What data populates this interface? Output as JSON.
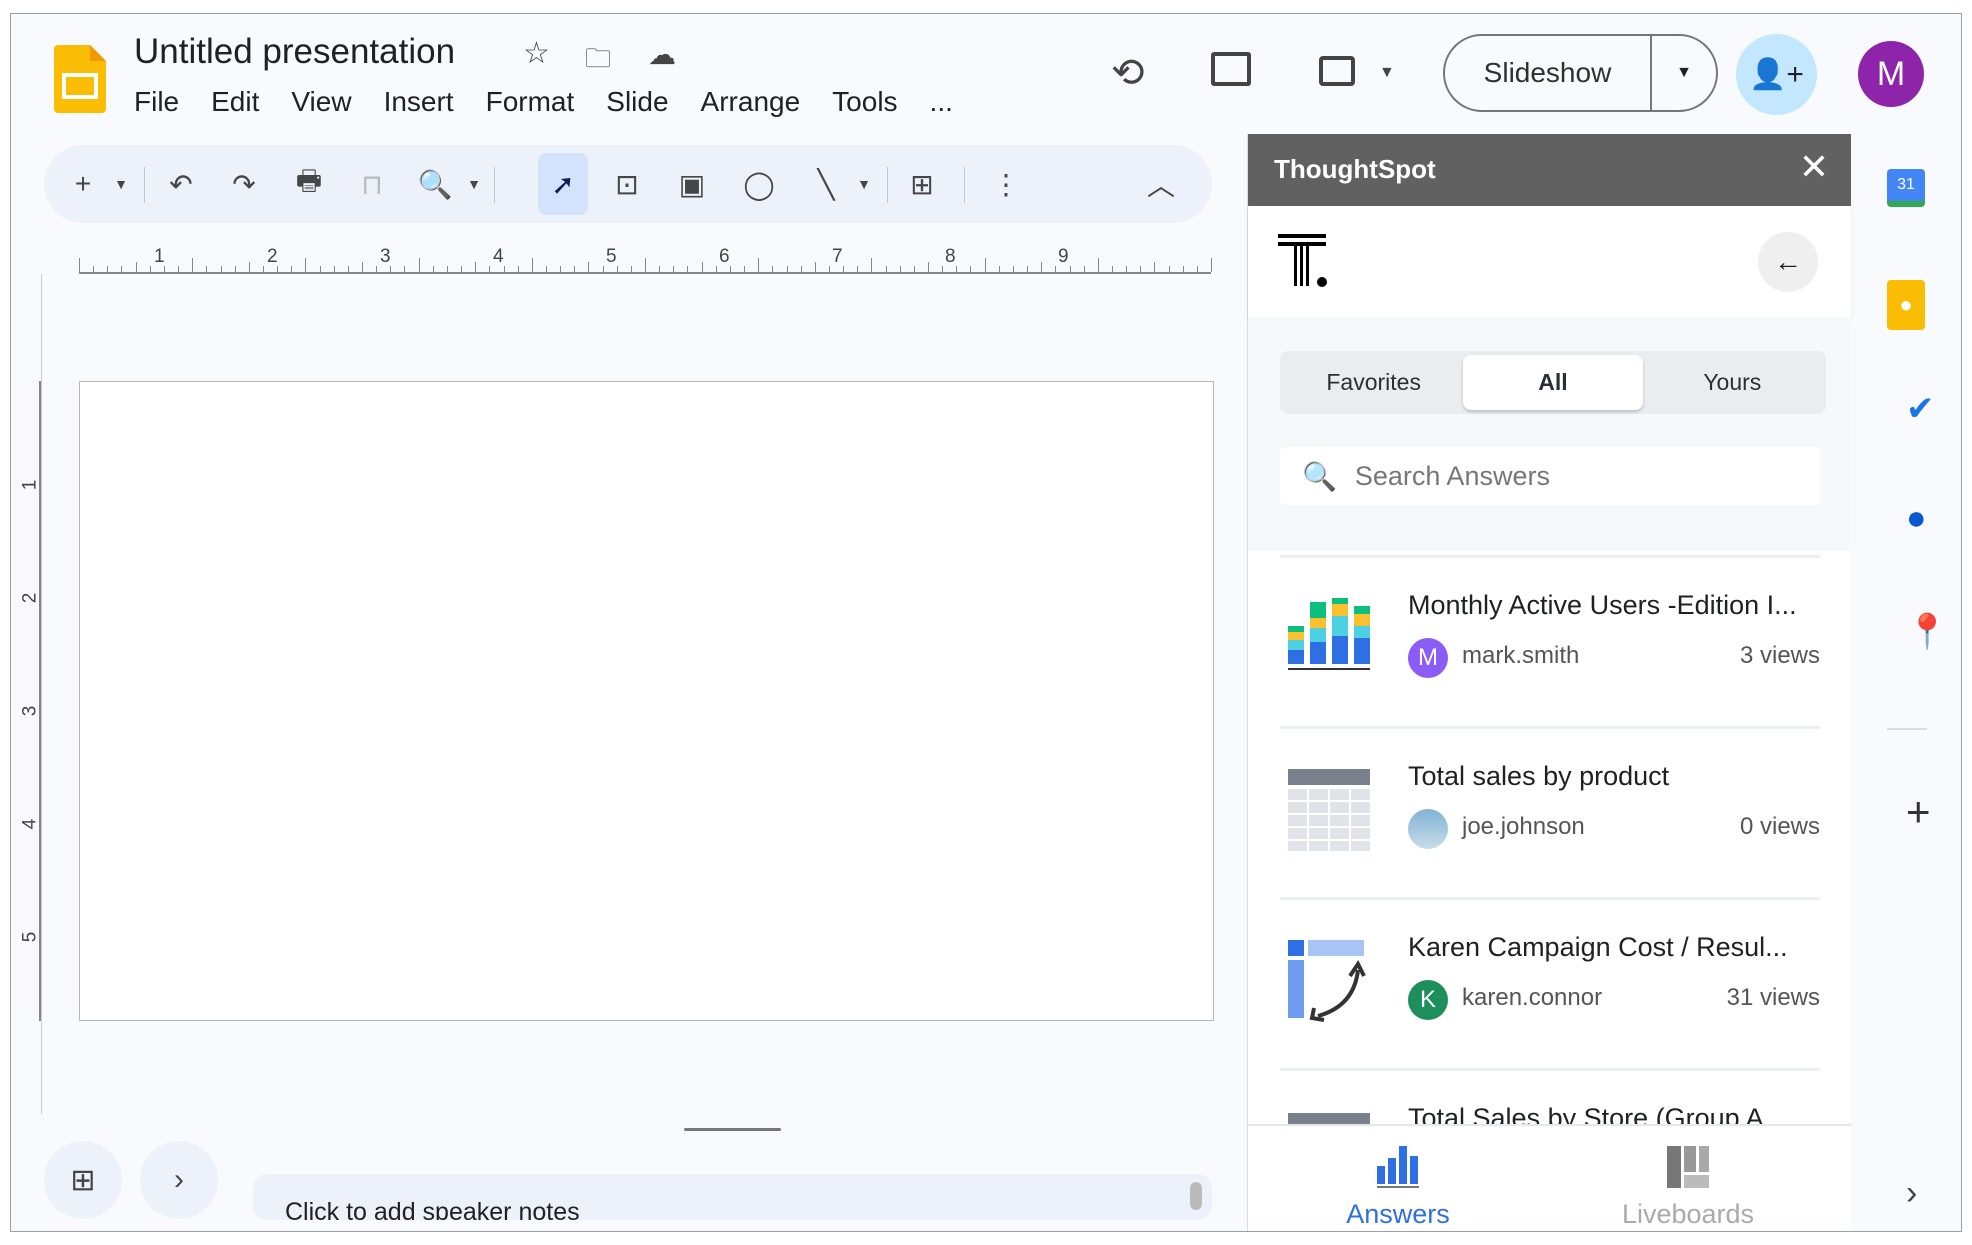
{
  "app": {
    "title": "Untitled presentation",
    "menu": [
      "File",
      "Edit",
      "View",
      "Insert",
      "Format",
      "Slide",
      "Arrange",
      "Tools",
      "..."
    ],
    "slideshow_label": "Slideshow",
    "avatar_letter": "M",
    "avatar_color": "#8e24aa"
  },
  "ruler": {
    "h": [
      "1",
      "2",
      "3",
      "4",
      "5",
      "6",
      "7",
      "8",
      "9"
    ],
    "v": [
      "1",
      "2",
      "3",
      "4",
      "5"
    ]
  },
  "notes": {
    "placeholder": "Click to add speaker notes"
  },
  "panel": {
    "title": "ThoughtSpot",
    "tabs": [
      "Favorites",
      "All",
      "Yours"
    ],
    "active_tab": "All",
    "search_placeholder": "Search Answers",
    "items": [
      {
        "title": "Monthly Active Users -Edition I...",
        "user": "mark.smith",
        "avatar": "M",
        "avatar_color": "#8b5cf6",
        "views": "3 views",
        "icon": "stacked-bar-chart-icon"
      },
      {
        "title": "Total sales by product",
        "user": "joe.johnson",
        "avatar": "",
        "avatar_color": "#6fa8c9",
        "views": "0 views",
        "icon": "table-icon"
      },
      {
        "title": "Karen Campaign Cost / Resul...",
        "user": "karen.connor",
        "avatar": "K",
        "avatar_color": "#1e8e5a",
        "views": "31 views",
        "icon": "pivot-icon"
      },
      {
        "title": "Total Sales by Store (Group A",
        "icon": "table-icon"
      }
    ],
    "nav": [
      {
        "label": "Answers",
        "active": true,
        "color": "#2f6fe4"
      },
      {
        "label": "Liveboards",
        "active": false,
        "color": "#aaaaaa"
      }
    ]
  }
}
